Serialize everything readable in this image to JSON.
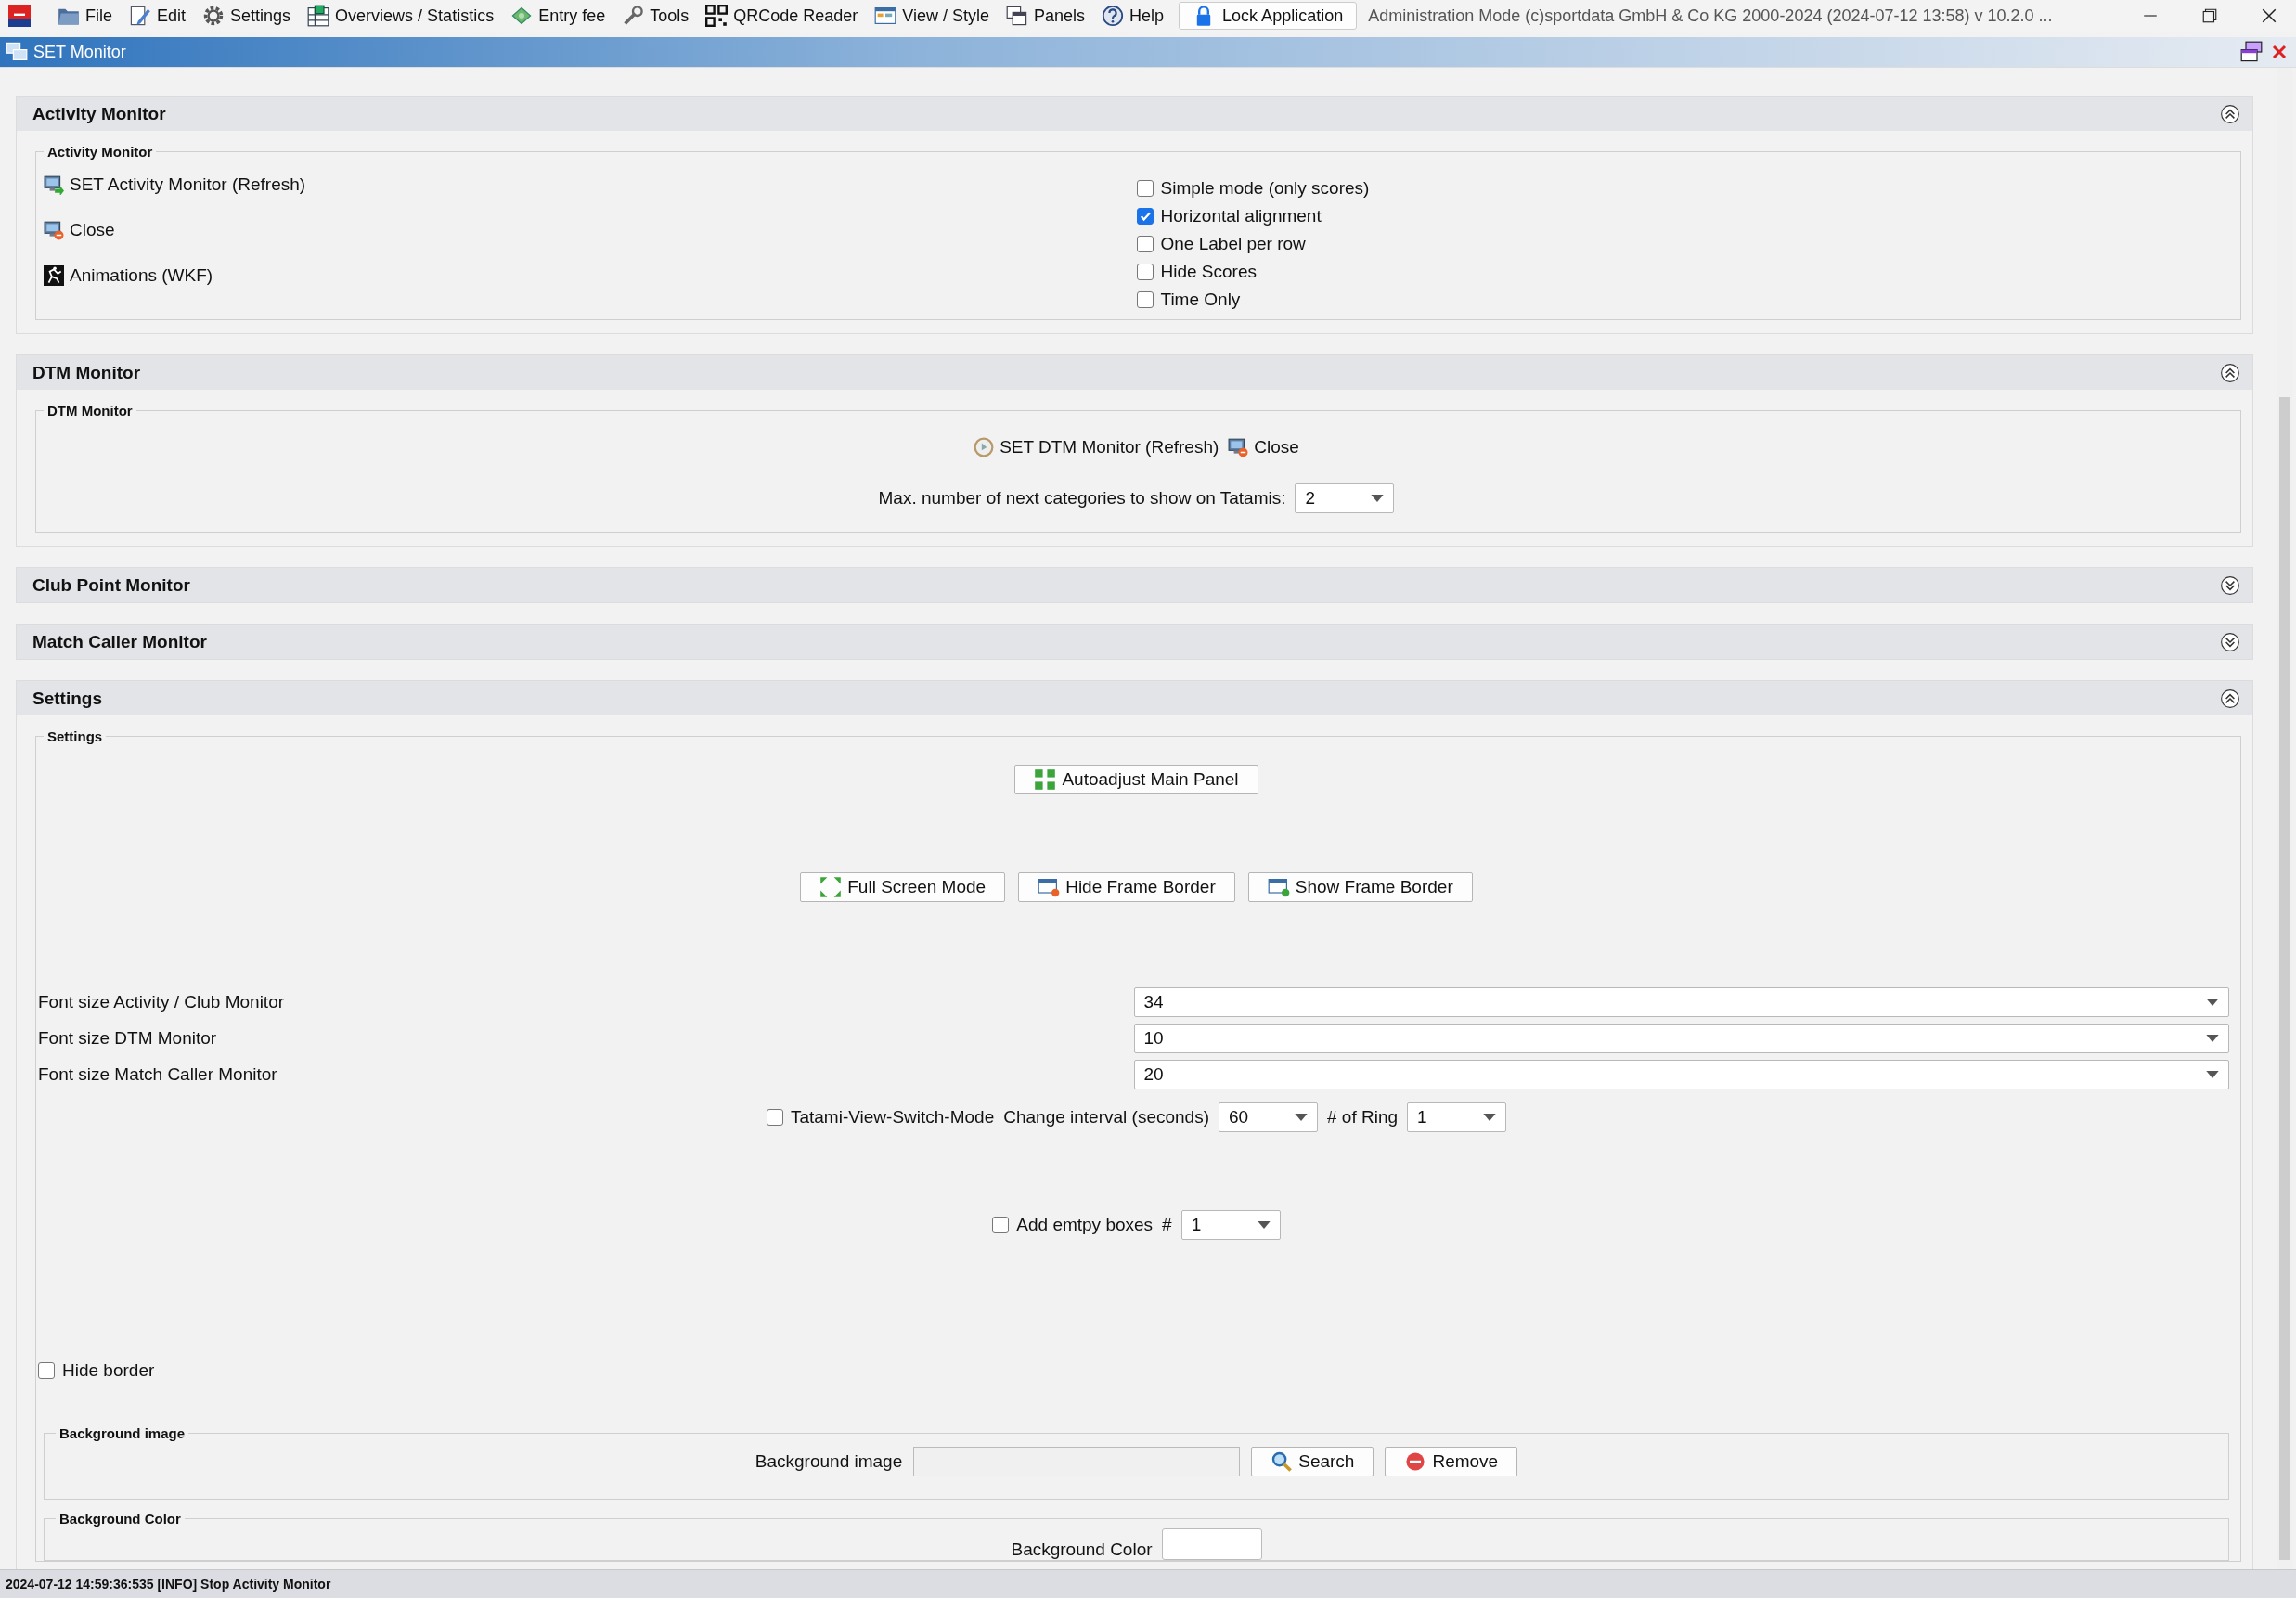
{
  "menu": {
    "items": [
      "File",
      "Edit",
      "Settings",
      "Overviews / Statistics",
      "Entry fee",
      "Tools",
      "QRCode Reader",
      "View / Style",
      "Panels",
      "Help"
    ],
    "lock_button": "Lock Application",
    "title": "Administration Mode (c)sportdata GmbH & Co KG 2000-2024 (2024-07-12 13:58)  v 10.2.0 ..."
  },
  "internal_window": {
    "title": "SET Monitor"
  },
  "sections": [
    {
      "kind": "activity",
      "title": "Activity Monitor",
      "expanded": true,
      "group_title": "Activity Monitor",
      "actions": [
        "SET Activity Monitor (Refresh)",
        "Close",
        "Animations (WKF)"
      ],
      "options": [
        {
          "label": "Simple mode (only scores)",
          "checked": false
        },
        {
          "label": "Horizontal alignment",
          "checked": true
        },
        {
          "label": "One Label per row",
          "checked": false
        },
        {
          "label": "Hide Scores",
          "checked": false
        },
        {
          "label": "Time Only",
          "checked": false
        }
      ]
    },
    {
      "kind": "dtm",
      "title": "DTM Monitor",
      "expanded": true,
      "group_title": "DTM Monitor",
      "actions": [
        "SET DTM Monitor (Refresh)",
        "Close"
      ],
      "max_label": "Max. number of next categories to show on Tatamis:",
      "max_value": "2"
    },
    {
      "title": "Club Point Monitor",
      "expanded": false
    },
    {
      "title": "Match Caller Monitor",
      "expanded": false
    },
    {
      "kind": "settings",
      "title": "Settings",
      "expanded": true,
      "group_title": "Settings",
      "autoadjust": "Autoadjust Main Panel",
      "frame_buttons": [
        "Full Screen Mode",
        "Hide Frame Border",
        "Show Frame Border"
      ],
      "font_sizes": [
        {
          "label": "Font size Activity / Club Monitor",
          "value": "34"
        },
        {
          "label": "Font size DTM Monitor",
          "value": "10"
        },
        {
          "label": "Font size Match Caller Monitor",
          "value": "20"
        }
      ],
      "tatami": {
        "label": "Tatami-View-Switch-Mode",
        "checked": false,
        "interval_label": "Change interval (seconds)",
        "interval_value": "60",
        "ring_label": "# of Ring",
        "ring_value": "1"
      },
      "empty_boxes": {
        "label": "Add emtpy boxes",
        "checked": false,
        "hash": "#",
        "value": "1"
      },
      "hide_border": {
        "label": "Hide border",
        "checked": false
      },
      "background_image": {
        "group_title": "Background image",
        "label": "Background image",
        "search": "Search",
        "remove": "Remove"
      },
      "background_color": {
        "group_title": "Background Color",
        "label": "Background Color"
      }
    }
  ],
  "status_bar": {
    "text": "2024-07-12 14:59:36:535 [INFO] Stop Activity Monitor"
  }
}
